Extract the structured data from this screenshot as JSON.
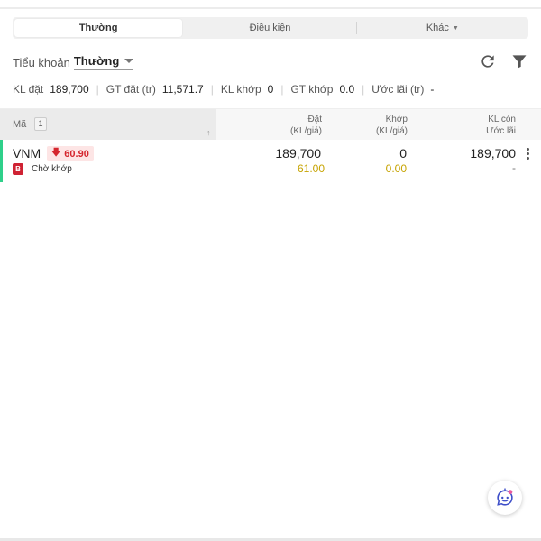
{
  "tabs": [
    {
      "label": "Thường",
      "active": true
    },
    {
      "label": "Điều kiện",
      "active": false
    },
    {
      "label": "Khác",
      "active": false,
      "has_dropdown": true
    }
  ],
  "account": {
    "label": "Tiểu khoản",
    "value": "Thường"
  },
  "toolbar": {
    "refresh_icon": "refresh-icon",
    "filter_icon": "filter-icon"
  },
  "summary": {
    "kl_dat_label": "KL đặt",
    "kl_dat_value": "189,700",
    "gt_dat_label": "GT đặt (tr)",
    "gt_dat_value": "11,571.7",
    "kl_khop_label": "KL khớp",
    "kl_khop_value": "0",
    "gt_khop_label": "GT khớp",
    "gt_khop_value": "0.0",
    "uoc_lai_label": "Ước lãi (tr)",
    "uoc_lai_value": "-"
  },
  "table": {
    "header": {
      "ma": "Mã",
      "ma_count": "1",
      "dat_line1": "Đặt",
      "dat_line2": "(KL/giá)",
      "khop_line1": "Khớp",
      "khop_line2": "(KL/giá)",
      "klcon_line1": "KL còn",
      "klcon_line2": "Ước lãi"
    },
    "rows": [
      {
        "symbol": "VNM",
        "change": "60.90",
        "change_direction": "down",
        "side": "B",
        "status": "Chờ khớp",
        "dat_kl": "189,700",
        "dat_gia": "61.00",
        "khop_kl": "0",
        "khop_gia": "0.00",
        "kl_con": "189,700",
        "uoc_lai": "-"
      }
    ]
  },
  "colors": {
    "accent_green": "#2fd08a",
    "down_red": "#d5262e",
    "price_yellow": "#c6a300",
    "buy_badge": "#cf2233"
  }
}
